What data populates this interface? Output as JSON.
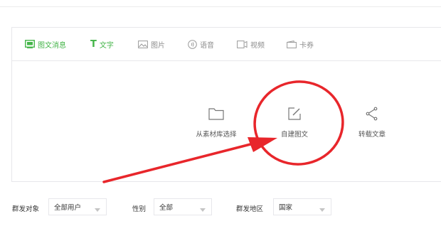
{
  "tabs": [
    {
      "label": "图文消息",
      "icon": "news-icon",
      "active": true
    },
    {
      "label": "文字",
      "icon": "text-icon",
      "active": false
    },
    {
      "label": "图片",
      "icon": "image-icon",
      "active": false
    },
    {
      "label": "语音",
      "icon": "voice-icon",
      "active": false
    },
    {
      "label": "视频",
      "icon": "video-icon",
      "active": false
    },
    {
      "label": "卡券",
      "icon": "coupon-icon",
      "active": false
    }
  ],
  "actions": [
    {
      "label": "从素材库选择",
      "icon": "folder-icon"
    },
    {
      "label": "自建图文",
      "icon": "edit-icon"
    },
    {
      "label": "转载文章",
      "icon": "share-icon"
    }
  ],
  "filters": {
    "target_label": "群发对象",
    "target_value": "全部用户",
    "gender_label": "性别",
    "gender_value": "全部",
    "region_label": "群发地区",
    "region_value": "国家"
  },
  "colors": {
    "accent": "#44b549",
    "annotation": "#e8262b",
    "border": "#e7e7eb",
    "muted_text": "#8d8d8d"
  }
}
